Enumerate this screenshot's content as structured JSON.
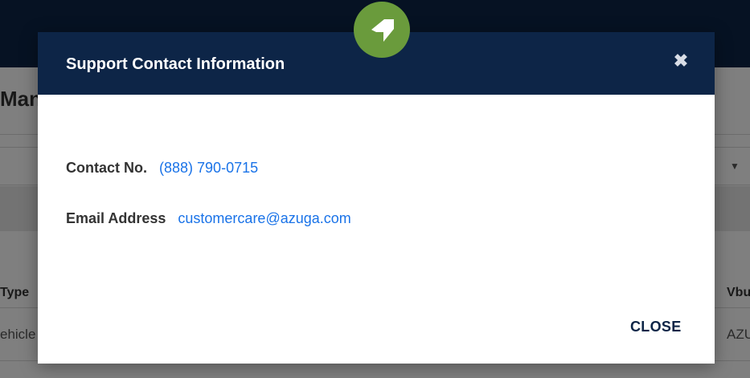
{
  "background": {
    "page_title_partial": "Man",
    "column_left_partial": "Type",
    "column_right_partial": "Vbu",
    "cell_left_partial": "ehicle",
    "cell_right_partial": "AZU",
    "dropdown_icon": "caret-down-icon"
  },
  "logo": {
    "icon": "azuga-logo-icon"
  },
  "modal": {
    "title": "Support Contact Information",
    "close_icon": "close-icon",
    "contact_label": "Contact No.",
    "contact_value": "(888) 790-0715",
    "email_label": "Email Address",
    "email_value": "customercare@azuga.com",
    "close_button_label": "CLOSE"
  },
  "colors": {
    "header_navy": "#0d2547",
    "logo_green": "#6a9b3c",
    "link_blue": "#1a73e8"
  }
}
